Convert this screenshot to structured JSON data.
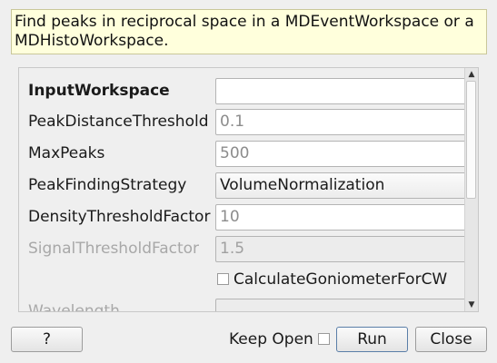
{
  "description": {
    "line1": "Find peaks in reciprocal space in a MDEventWorkspace or a",
    "line2": "MDHistoWorkspace."
  },
  "properties": [
    {
      "label": "InputWorkspace",
      "value": "",
      "style": "bold"
    },
    {
      "label": "PeakDistanceThreshold",
      "value": "0.1",
      "style": "normal"
    },
    {
      "label": "MaxPeaks",
      "value": "500",
      "style": "normal"
    },
    {
      "label": "PeakFindingStrategy",
      "value": "VolumeNormalization",
      "style": "combo"
    },
    {
      "label": "DensityThresholdFactor",
      "value": "10",
      "style": "normal"
    },
    {
      "label": "SignalThresholdFactor",
      "value": "1.5",
      "style": "disabled"
    }
  ],
  "checkbox": {
    "label": "CalculateGoniometerForCW",
    "checked": false
  },
  "partial_row": {
    "label": "Wavelength"
  },
  "scrollbar": {
    "up_icon": "scroll-up-arrow-icon",
    "down_icon": "scroll-down-arrow-icon"
  },
  "footer": {
    "help_label": "?",
    "keep_open_label": "Keep Open",
    "keep_open_checked": false,
    "run_label": "Run",
    "close_label": "Close"
  }
}
